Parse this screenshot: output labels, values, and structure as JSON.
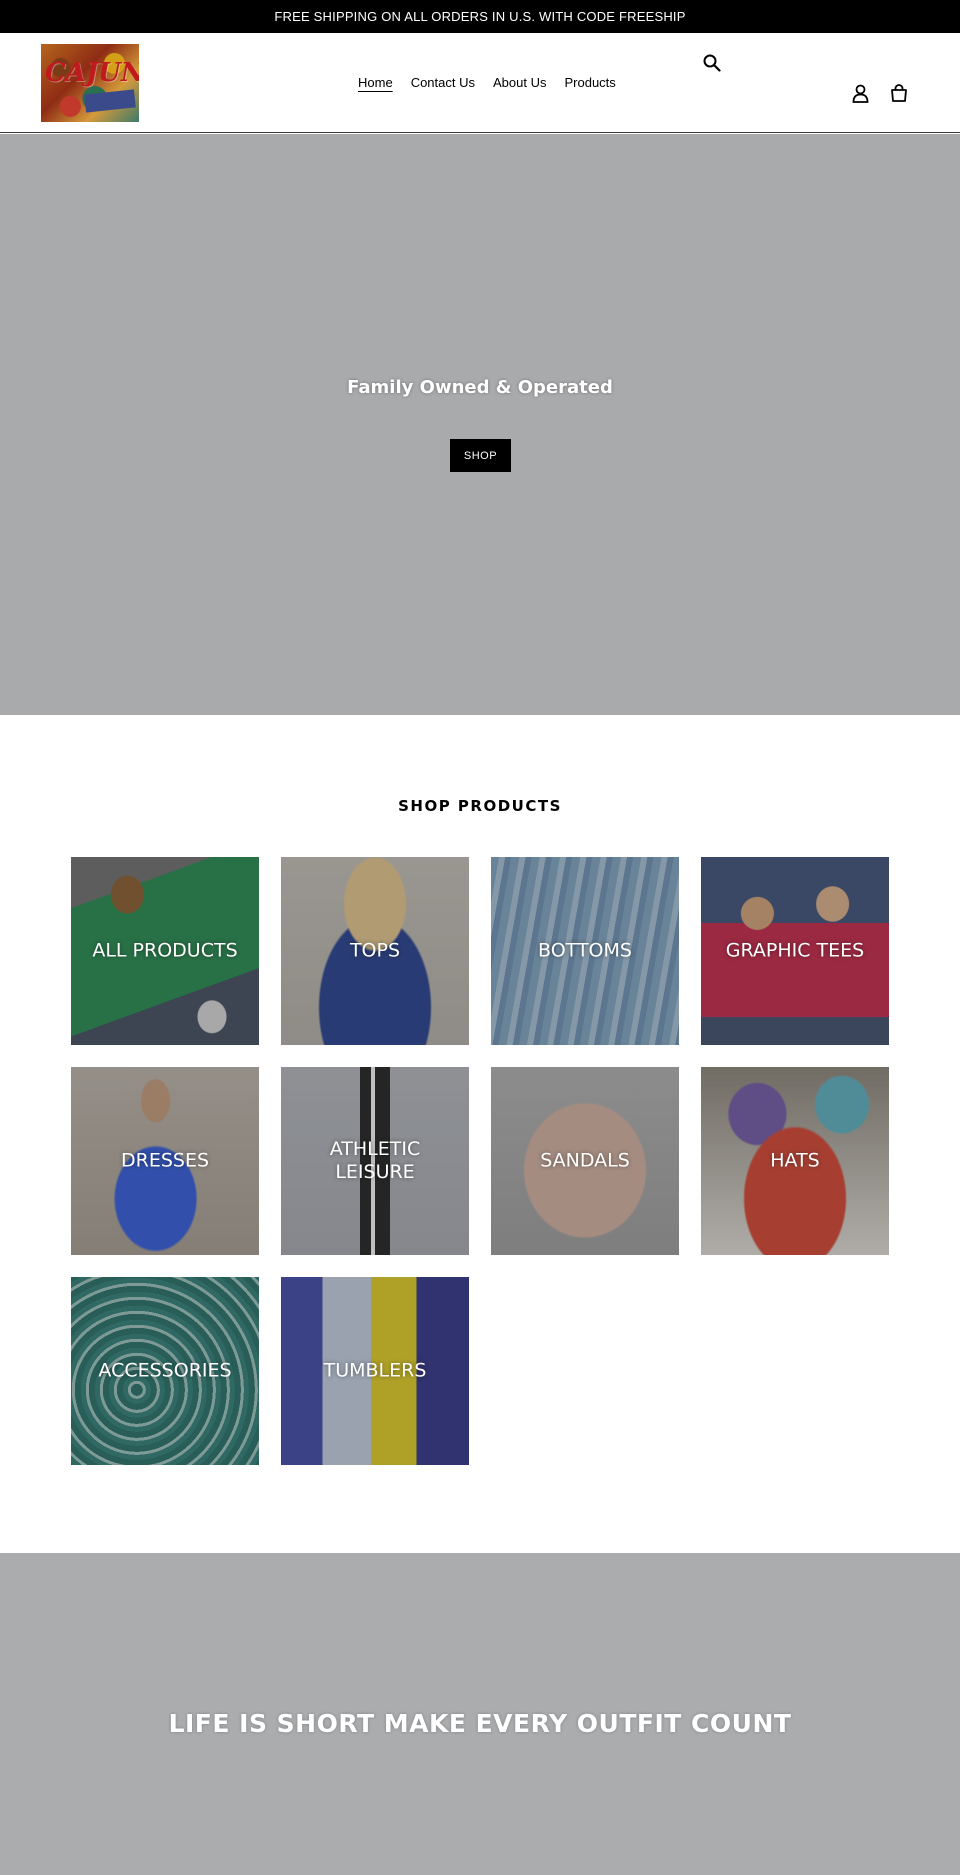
{
  "announcement": {
    "text": "FREE SHIPPING ON ALL ORDERS IN U.S. WITH CODE FREESHIP"
  },
  "header": {
    "logo": {
      "text": "CAJUN",
      "sub": ""
    },
    "nav": [
      {
        "label": "Home",
        "active": true
      },
      {
        "label": "Contact Us",
        "active": false
      },
      {
        "label": "About Us",
        "active": false
      },
      {
        "label": "Products",
        "active": false
      }
    ],
    "icons": [
      "search-icon",
      "account-icon",
      "cart-icon"
    ]
  },
  "hero": {
    "title": "Family Owned & Operated",
    "button_label": "SHOP",
    "background": "#a9aaac"
  },
  "collections": {
    "title": "SHOP PRODUCTS",
    "items": [
      {
        "label": "ALL PRODUCTS"
      },
      {
        "label": "TOPS"
      },
      {
        "label": "BOTTOMS"
      },
      {
        "label": "GRAPHIC TEES"
      },
      {
        "label": "DRESSES"
      },
      {
        "label": "ATHLETIC LEISURE"
      },
      {
        "label": "SANDALS"
      },
      {
        "label": "HATS"
      },
      {
        "label": "ACCESSORIES"
      },
      {
        "label": "TUMBLERS"
      }
    ]
  },
  "banner": {
    "text": "LIFE IS SHORT MAKE EVERY OUTFIT COUNT",
    "background": "#abacae"
  }
}
